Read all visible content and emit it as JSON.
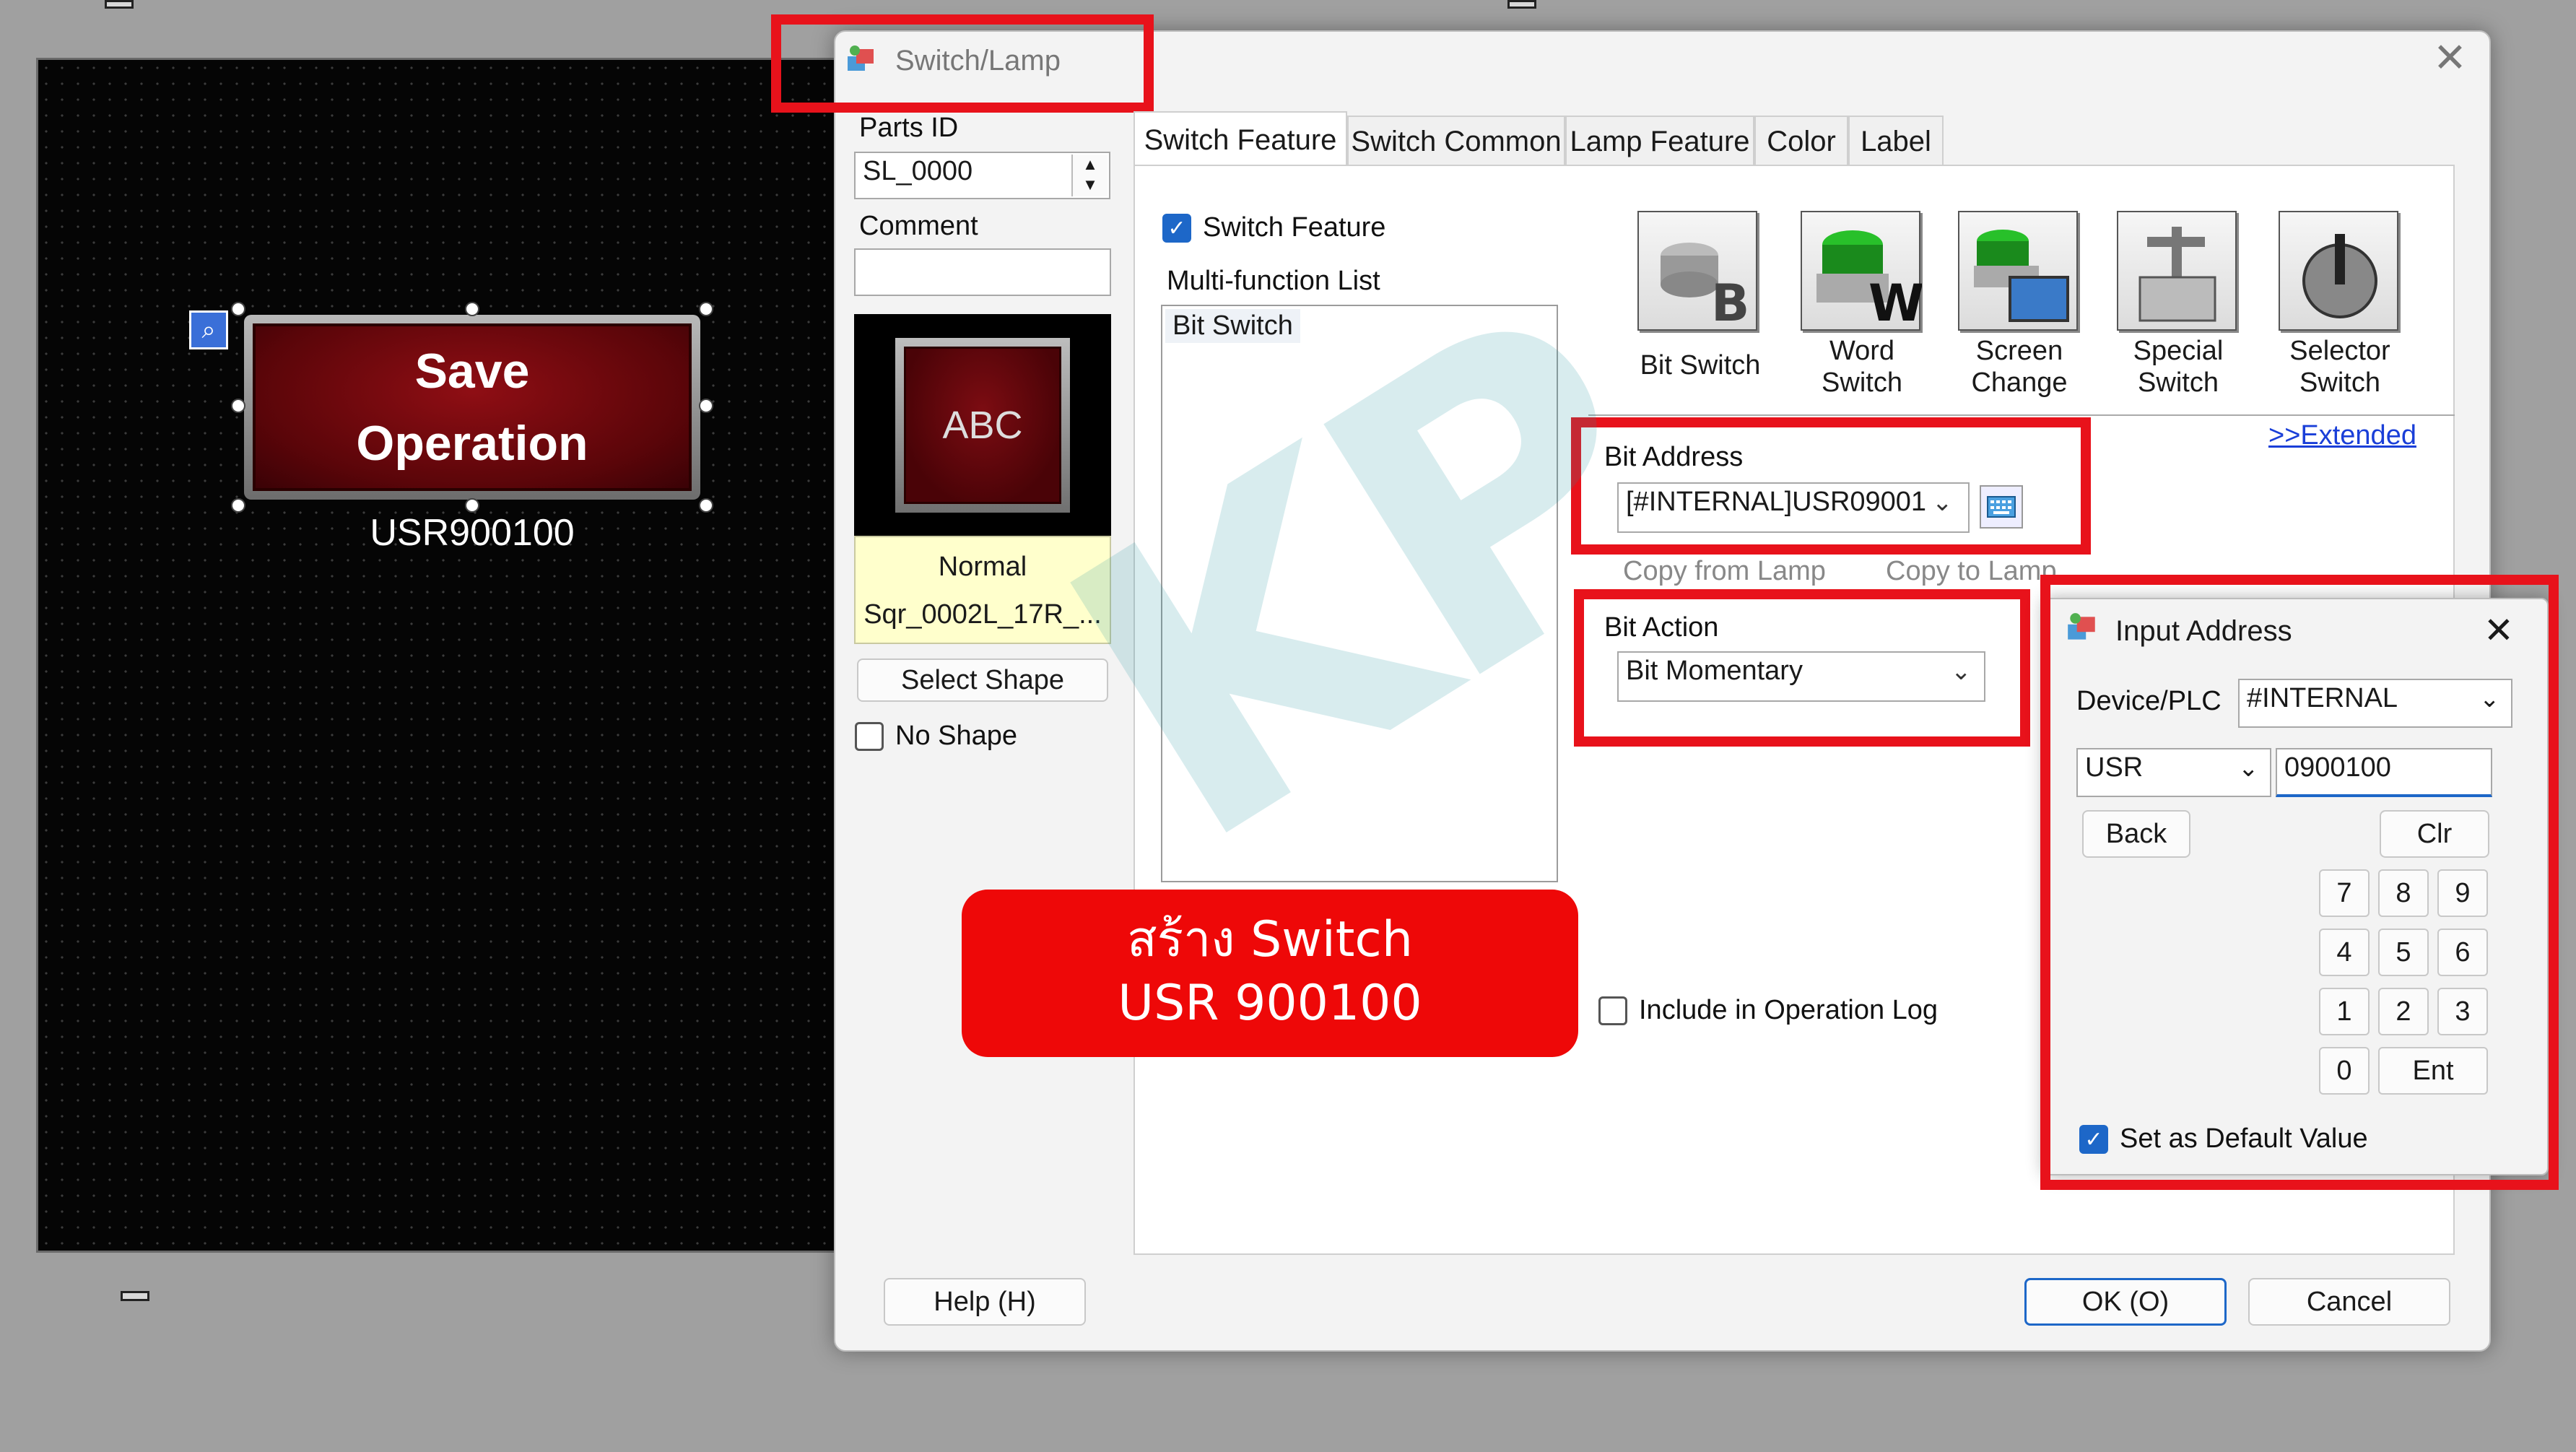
{
  "canvas": {
    "button_label": "Save\nOperation",
    "address_label": "USR900100"
  },
  "dialog": {
    "title": "Switch/Lamp",
    "close": "✕",
    "parts_id_label": "Parts ID",
    "parts_id_value": "SL_0000",
    "comment_label": "Comment",
    "comment_value": "",
    "preview_text": "ABC",
    "preview_state": "Normal",
    "preview_shape": "Sqr_0002L_17R_...",
    "select_shape_label": "Select Shape",
    "no_shape_label": "No Shape",
    "help_label": "Help (H)",
    "ok_label": "OK (O)",
    "cancel_label": "Cancel",
    "tabs": [
      {
        "label": "Switch Feature"
      },
      {
        "label": "Switch Common"
      },
      {
        "label": "Lamp Feature"
      },
      {
        "label": "Color"
      },
      {
        "label": "Label"
      }
    ],
    "switch_feature_label": "Switch Feature",
    "multi_function_label": "Multi-function List",
    "multi_function_items": [
      "Bit Switch"
    ],
    "switch_types": [
      {
        "label": "Bit Switch",
        "glyph": "B"
      },
      {
        "label": "Word\nSwitch",
        "glyph": "W"
      },
      {
        "label": "Screen\nChange",
        "glyph": ""
      },
      {
        "label": "Special\nSwitch",
        "glyph": ""
      },
      {
        "label": "Selector\nSwitch",
        "glyph": ""
      }
    ],
    "extended_link": ">>Extended",
    "bit_address_label": "Bit Address",
    "bit_address_value": "[#INTERNAL]USR09001",
    "copy_from_lamp": "Copy from Lamp",
    "copy_to_lamp": "Copy to Lamp",
    "bit_action_label": "Bit Action",
    "bit_action_value": "Bit Momentary",
    "include_log_label": "Include in Operation Log"
  },
  "input_address": {
    "title": "Input Address",
    "close": "✕",
    "device_label": "Device/PLC",
    "device_value": "#INTERNAL",
    "area_value": "USR",
    "address_value": "0900100",
    "back_label": "Back",
    "clr_label": "Clr",
    "keys": [
      "7",
      "8",
      "9",
      "4",
      "5",
      "6",
      "1",
      "2",
      "3",
      "0"
    ],
    "ent_label": "Ent",
    "default_label": "Set as Default Value"
  },
  "callout": {
    "text": "สร้าง Switch\nUSR 900100"
  },
  "watermark": {
    "text": "KP"
  },
  "colors": {
    "highlight": "#e8121b",
    "callout": "#ee0808",
    "accent": "#1d67c8"
  }
}
